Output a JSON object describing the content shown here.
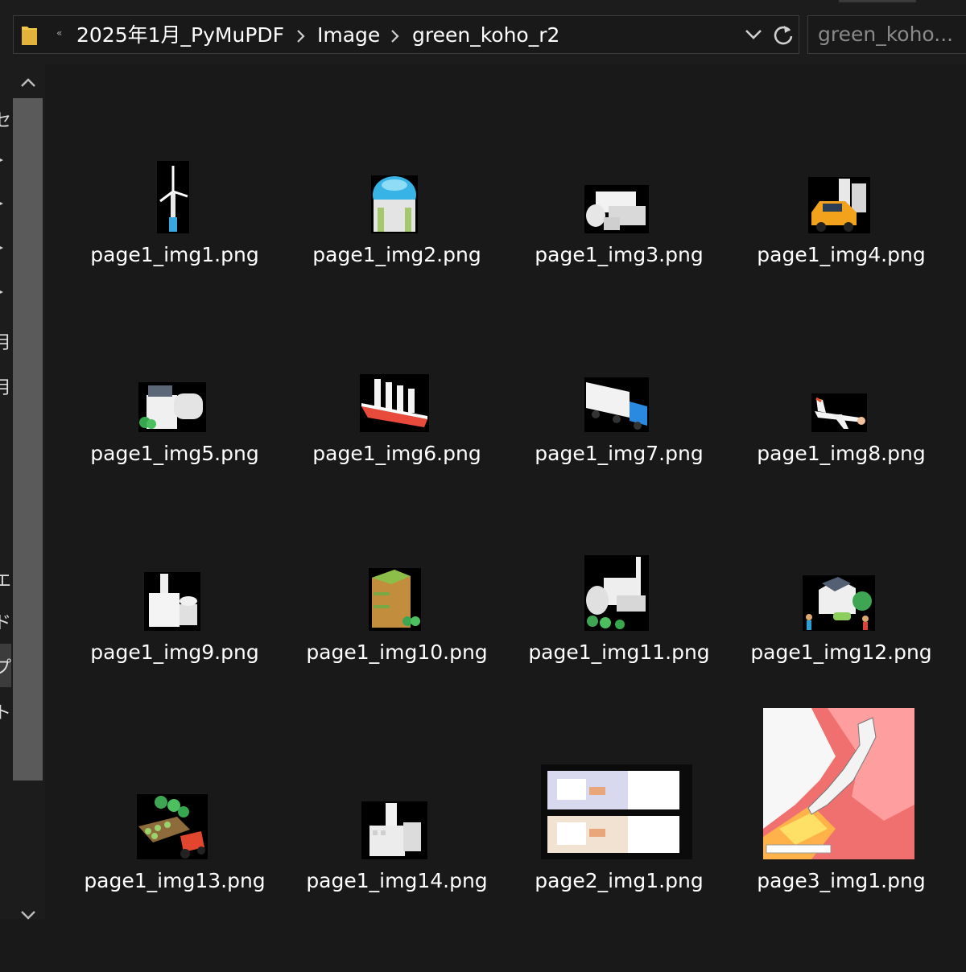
{
  "address_bar": {
    "overflow_label": "«",
    "breadcrumbs": [
      "2025年1月_PyMuPDF",
      "Image",
      "green_koho_r2"
    ],
    "separator_icon": "chevron-right-icon",
    "dropdown_icon": "chevron-down-icon",
    "refresh_icon": "refresh-icon"
  },
  "search": {
    "placeholder": "green_koho..."
  },
  "nav_pane": {
    "partial_labels": [
      "セ",
      "月",
      "月",
      "エ",
      "ド",
      "プ",
      "ト"
    ],
    "scroll_up_icon": "chevron-up-icon",
    "scroll_down_icon": "chevron-down-icon"
  },
  "files": [
    {
      "name": "page1_img1.png",
      "icon": "wind-turbine-thumbnail"
    },
    {
      "name": "page1_img2.png",
      "icon": "hydrogen-tank-thumbnail"
    },
    {
      "name": "page1_img3.png",
      "icon": "industrial-plant-thumbnail"
    },
    {
      "name": "page1_img4.png",
      "icon": "car-station-thumbnail"
    },
    {
      "name": "page1_img5.png",
      "icon": "solar-building-thumbnail"
    },
    {
      "name": "page1_img6.png",
      "icon": "sail-ship-thumbnail"
    },
    {
      "name": "page1_img7.png",
      "icon": "truck-thumbnail"
    },
    {
      "name": "page1_img8.png",
      "icon": "airplane-thumbnail"
    },
    {
      "name": "page1_img9.png",
      "icon": "factory-thumbnail"
    },
    {
      "name": "page1_img10.png",
      "icon": "green-building-thumbnail"
    },
    {
      "name": "page1_img11.png",
      "icon": "power-plant-thumbnail"
    },
    {
      "name": "page1_img12.png",
      "icon": "house-family-thumbnail"
    },
    {
      "name": "page1_img13.png",
      "icon": "farm-tractor-thumbnail"
    },
    {
      "name": "page1_img14.png",
      "icon": "factory-gray-thumbnail"
    },
    {
      "name": "page2_img1.png",
      "icon": "document-diagram-thumbnail"
    },
    {
      "name": "page3_img1.png",
      "icon": "japan-map-thumbnail"
    }
  ],
  "colors": {
    "background": "#191919",
    "folder": "#f2c84b",
    "text": "#ffffff"
  }
}
